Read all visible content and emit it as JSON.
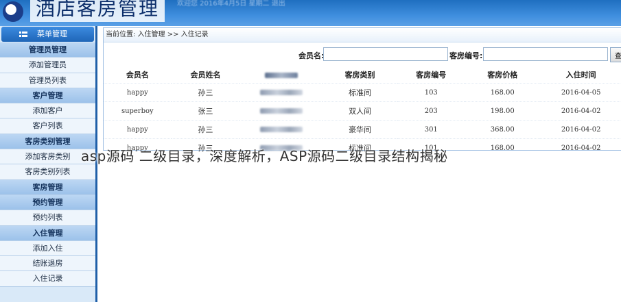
{
  "header": {
    "title": "酒店客房管理",
    "info": "欢迎您 2016年4月5日 星期二 退出"
  },
  "sidebar": {
    "top_label": "菜单管理",
    "items": [
      {
        "label": "管理员管理",
        "type": "group"
      },
      {
        "label": "添加管理员",
        "type": "sub"
      },
      {
        "label": "管理员列表",
        "type": "sub"
      },
      {
        "label": "客户管理",
        "type": "group"
      },
      {
        "label": "添加客户",
        "type": "sub"
      },
      {
        "label": "客户列表",
        "type": "sub"
      },
      {
        "label": "客房类别管理",
        "type": "group"
      },
      {
        "label": "添加客房类别",
        "type": "sub"
      },
      {
        "label": "客房类别列表",
        "type": "sub"
      },
      {
        "label": "客房管理",
        "type": "group"
      },
      {
        "label": "预约管理",
        "type": "group"
      },
      {
        "label": "预约列表",
        "type": "sub"
      },
      {
        "label": "入住管理",
        "type": "group"
      },
      {
        "label": "添加入住",
        "type": "sub"
      },
      {
        "label": "结账退房",
        "type": "sub"
      },
      {
        "label": "入住记录",
        "type": "sub"
      }
    ]
  },
  "main": {
    "breadcrumb": "当前位置: 入住管理 >> 入住记录",
    "search": {
      "member_label": "会员名:",
      "member_value": "",
      "room_label": "客房编号:",
      "room_value": "",
      "button_label": "查"
    },
    "table": {
      "headers": [
        "会员名",
        "会员姓名",
        "",
        "客房类别",
        "客房编号",
        "客房价格",
        "入住时间"
      ],
      "rows": [
        [
          "happy",
          "孙三",
          "",
          "标准间",
          "103",
          "168.00",
          "2016-04-05"
        ],
        [
          "superboy",
          "张三",
          "",
          "双人间",
          "203",
          "198.00",
          "2016-04-02"
        ],
        [
          "happy",
          "孙三",
          "",
          "豪华间",
          "301",
          "368.00",
          "2016-04-02"
        ],
        [
          "happy",
          "孙三",
          "",
          "标准间",
          "101",
          "168.00",
          "2016-04-02"
        ]
      ]
    }
  },
  "caption": "asp源码 二级目录，深度解析，ASP源码二级目录结构揭秘"
}
